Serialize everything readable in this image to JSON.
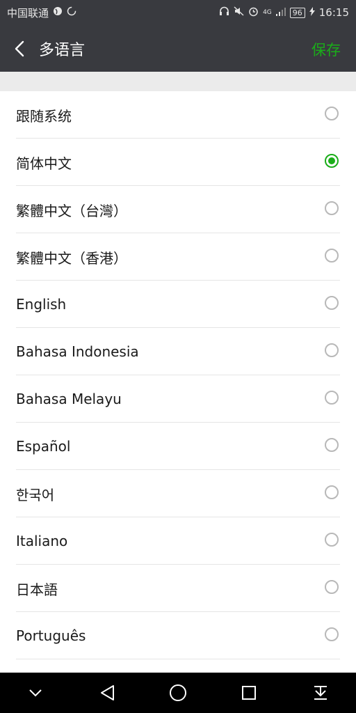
{
  "status_bar": {
    "carrier": "中国联通",
    "network": "4G",
    "battery": "96",
    "time": "16:15"
  },
  "header": {
    "title": "多语言",
    "save_label": "保存"
  },
  "languages": [
    {
      "label": "跟随系统",
      "selected": false
    },
    {
      "label": "简体中文",
      "selected": true
    },
    {
      "label": "繁體中文（台灣）",
      "selected": false
    },
    {
      "label": "繁體中文（香港）",
      "selected": false
    },
    {
      "label": "English",
      "selected": false
    },
    {
      "label": "Bahasa Indonesia",
      "selected": false
    },
    {
      "label": "Bahasa Melayu",
      "selected": false
    },
    {
      "label": "Español",
      "selected": false
    },
    {
      "label": "한국어",
      "selected": false
    },
    {
      "label": "Italiano",
      "selected": false
    },
    {
      "label": "日本語",
      "selected": false
    },
    {
      "label": "Português",
      "selected": false
    }
  ],
  "colors": {
    "header_bg": "#393a3f",
    "accent": "#1aad19"
  },
  "icons": {
    "back": "chevron-left-icon",
    "nav": [
      "chevron-down-icon",
      "back-triangle-icon",
      "home-circle-icon",
      "recents-square-icon",
      "notification-pull-icon"
    ]
  }
}
